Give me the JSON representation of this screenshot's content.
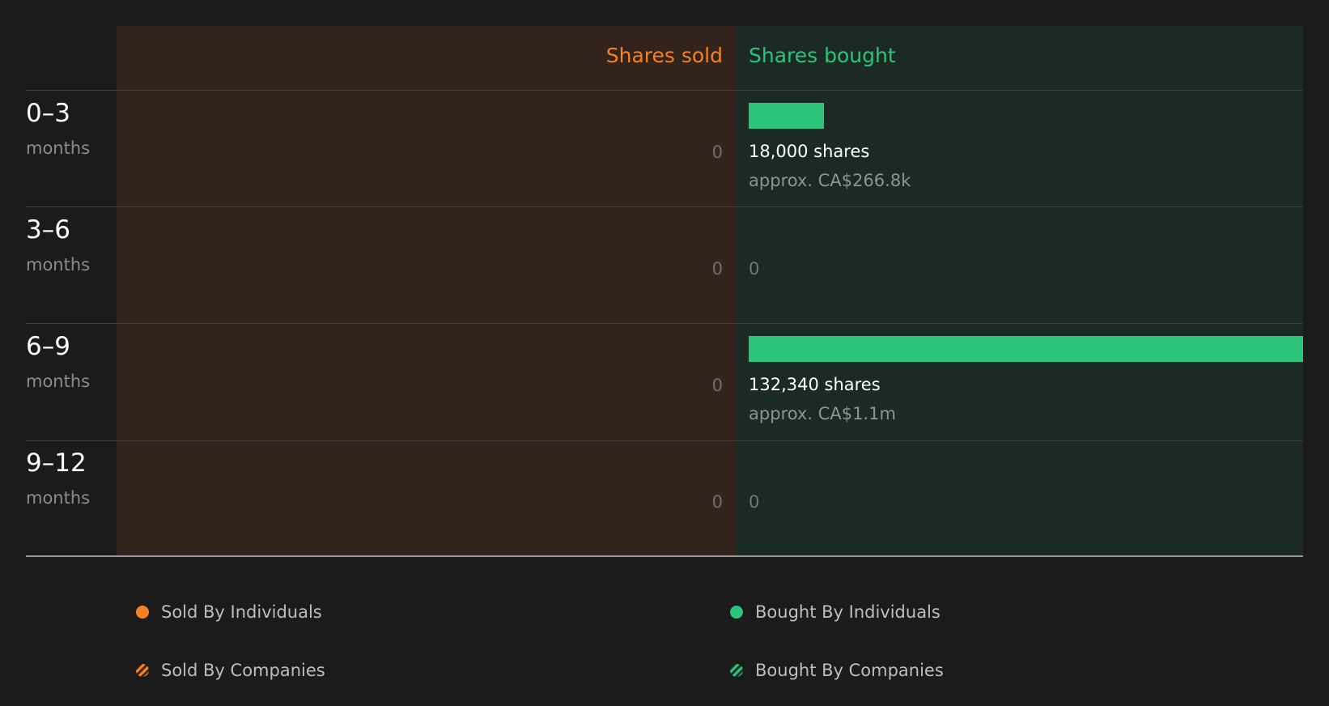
{
  "colors": {
    "sold": "#f58220",
    "bought": "#2cc47a",
    "sold_bg": "#32231c",
    "bought_bg": "#1b2a24"
  },
  "chart_data": {
    "type": "bar",
    "headers": {
      "sold": "Shares sold",
      "bought": "Shares bought"
    },
    "categories": [
      {
        "range": "0–3",
        "unit": "months"
      },
      {
        "range": "3–6",
        "unit": "months"
      },
      {
        "range": "6–9",
        "unit": "months"
      },
      {
        "range": "9–12",
        "unit": "months"
      }
    ],
    "series": [
      {
        "name": "Shares sold",
        "values": [
          0,
          0,
          0,
          0
        ]
      },
      {
        "name": "Shares bought",
        "values": [
          18000,
          0,
          132340,
          0
        ]
      }
    ],
    "sold_zero_labels": [
      "0",
      "0",
      "0",
      "0"
    ],
    "bought_labels": [
      {
        "shares": "18,000 shares",
        "value": "approx. CA$266.8k"
      },
      {
        "zero": "0"
      },
      {
        "shares": "132,340 shares",
        "value": "approx. CA$1.1m"
      },
      {
        "zero": "0"
      }
    ],
    "legend": [
      {
        "label": "Sold By Individuals",
        "icon": "orange-dot-icon"
      },
      {
        "label": "Bought By Individuals",
        "icon": "green-dot-icon"
      },
      {
        "label": "Sold By Companies",
        "icon": "orange-striped-icon"
      },
      {
        "label": "Bought By Companies",
        "icon": "green-striped-icon"
      }
    ]
  }
}
